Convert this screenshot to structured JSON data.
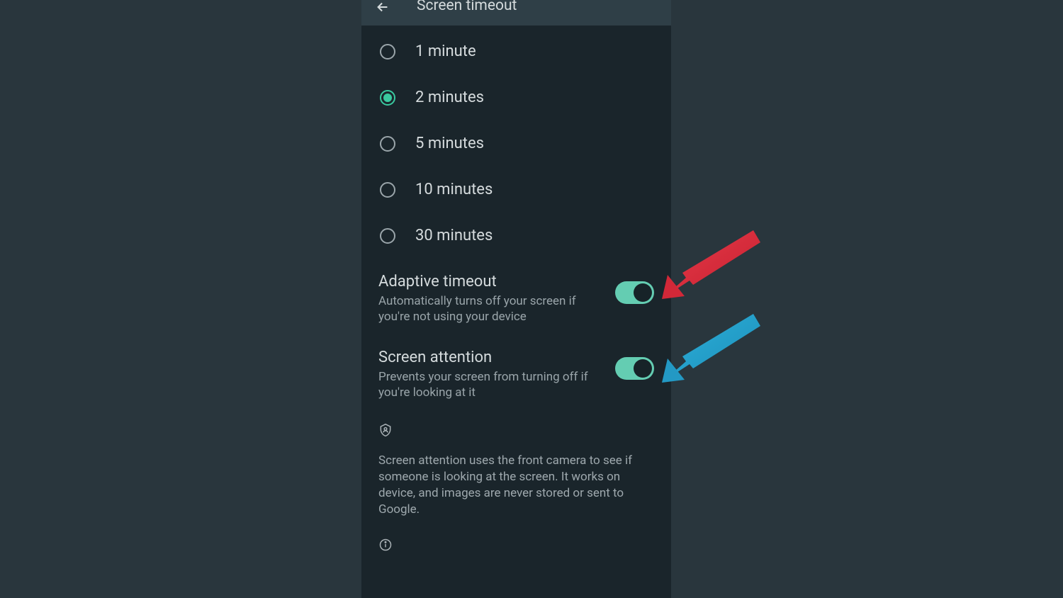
{
  "header": {
    "title": "Screen timeout"
  },
  "radio_options": [
    {
      "label": "1 minute",
      "selected": false
    },
    {
      "label": "2 minutes",
      "selected": true
    },
    {
      "label": "5 minutes",
      "selected": false
    },
    {
      "label": "10 minutes",
      "selected": false
    },
    {
      "label": "30 minutes",
      "selected": false
    }
  ],
  "toggles": {
    "adaptive": {
      "title": "Adaptive timeout",
      "desc": "Automatically turns off your screen if you're not using your device",
      "on": true
    },
    "attention": {
      "title": "Screen attention",
      "desc": "Prevents your screen from turning off if you're looking at it",
      "on": true
    }
  },
  "privacy_note": "Screen attention uses the front camera to see if someone is looking at the screen. It works on device, and images are never stored or sent to Google.",
  "annotations": {
    "arrow_red_target": "adaptive-timeout-toggle",
    "arrow_blue_target": "screen-attention-toggle"
  }
}
